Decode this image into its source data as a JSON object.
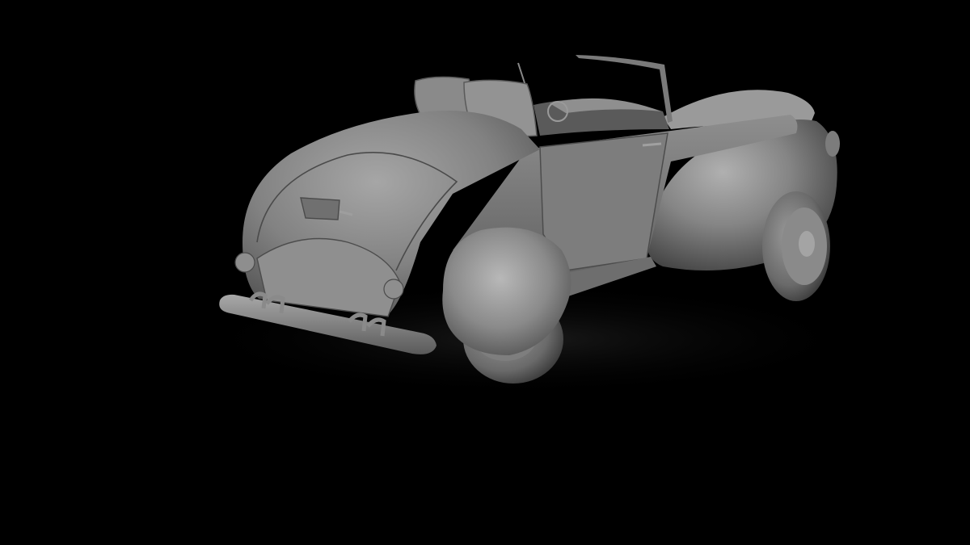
{
  "scene": {
    "subject": "car-render",
    "background_color": "#000000",
    "body_color": "#8c8c8c",
    "shadow_color": "#3a3a3a",
    "highlight_color": "#b4b4b4"
  }
}
